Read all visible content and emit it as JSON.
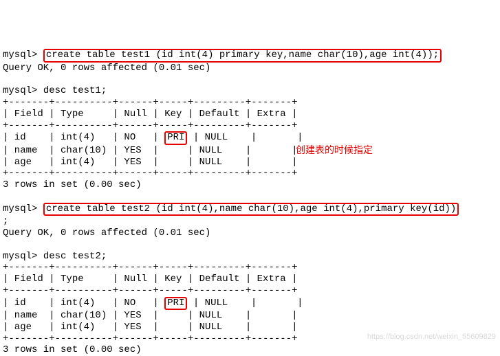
{
  "prompt": "mysql>",
  "continuation": ";",
  "cmd1": "create table test1 (id int(4) primary key,name char(10),age int(4));",
  "resp1": "Query OK, 0 rows affected (0.01 sec)",
  "cmd2": "desc test1;",
  "sep1": "+-------+----------+------+-----+---------+-------+",
  "hdr1": "| Field | Type     | Null | Key | Default | Extra |",
  "t1r1a": "| id    | int(4)   | NO   | ",
  "t1r1k": "PRI",
  "t1r1b": " | NULL    |       |",
  "t1r2": "| name  | char(10) | YES  |     | NULL    |       |",
  "t1r3": "| age   | int(4)   | YES  |     | NULL    |       |",
  "rowsmsg": "3 rows in set (0.00 sec)",
  "annotation": "创建表的时候指定",
  "cmd3": "create table test2 (id int(4),name char(10),age int(4),primary key(id))",
  "cmd4": "desc test2;",
  "t2r1a": "| id    | int(4)   | NO   | ",
  "t2r1k": "PRI",
  "t2r1b": " | NULL    |       |",
  "t2r2": "| name  | char(10) | YES  |     | NULL    |       |",
  "t2r3": "| age   | int(4)   | YES  |     | NULL    |       |",
  "watermark": "https://blog.csdn.net/weixin_55609829",
  "chart_data": {
    "type": "table",
    "tables": [
      {
        "name": "desc test1",
        "columns": [
          "Field",
          "Type",
          "Null",
          "Key",
          "Default",
          "Extra"
        ],
        "rows": [
          [
            "id",
            "int(4)",
            "NO",
            "PRI",
            "NULL",
            ""
          ],
          [
            "name",
            "char(10)",
            "YES",
            "",
            "NULL",
            ""
          ],
          [
            "age",
            "int(4)",
            "YES",
            "",
            "NULL",
            ""
          ]
        ]
      },
      {
        "name": "desc test2",
        "columns": [
          "Field",
          "Type",
          "Null",
          "Key",
          "Default",
          "Extra"
        ],
        "rows": [
          [
            "id",
            "int(4)",
            "NO",
            "PRI",
            "NULL",
            ""
          ],
          [
            "name",
            "char(10)",
            "YES",
            "",
            "NULL",
            ""
          ],
          [
            "age",
            "int(4)",
            "YES",
            "",
            "NULL",
            ""
          ]
        ]
      }
    ]
  }
}
